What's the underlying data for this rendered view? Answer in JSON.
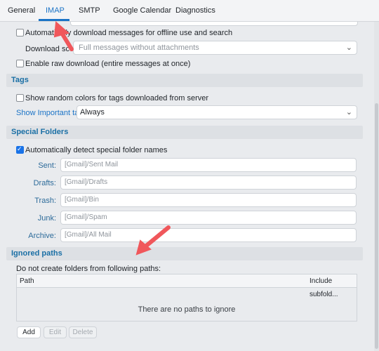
{
  "tabs": [
    {
      "label": "General"
    },
    {
      "label": "IMAP"
    },
    {
      "label": "SMTP"
    },
    {
      "label": "Google Calendar"
    },
    {
      "label": "Diagnostics"
    }
  ],
  "active_tab": "IMAP",
  "download": {
    "auto_download_label": "Automatically download messages for offline use and search",
    "download_scope_label": "Download scope:",
    "download_scope_value": "Full messages without attachments",
    "raw_download_label": "Enable raw download (entire messages at once)"
  },
  "tags": {
    "section_title": "Tags",
    "random_colors_label": "Show random colors for tags downloaded from server",
    "important_tags_label": "Show Important tags:",
    "important_tags_value": "Always"
  },
  "special_folders": {
    "section_title": "Special Folders",
    "auto_detect_label": "Automatically detect special folder names",
    "fields": [
      {
        "label": "Sent:",
        "placeholder": "[Gmail]/Sent Mail"
      },
      {
        "label": "Drafts:",
        "placeholder": "[Gmail]/Drafts"
      },
      {
        "label": "Trash:",
        "placeholder": "[Gmail]/Bin"
      },
      {
        "label": "Junk:",
        "placeholder": "[Gmail]/Spam"
      },
      {
        "label": "Archive:",
        "placeholder": "[Gmail]/All Mail"
      }
    ]
  },
  "ignored_paths": {
    "section_title": "Ignored paths",
    "description": "Do not create folders from following paths:",
    "columns": [
      "Path",
      "Include subfold..."
    ],
    "empty_text": "There are no paths to ignore",
    "buttons": {
      "add": "Add",
      "edit": "Edit",
      "delete": "Delete"
    }
  },
  "colors": {
    "accent": "#1a73c6",
    "annotation_arrow": "#f0575b"
  }
}
